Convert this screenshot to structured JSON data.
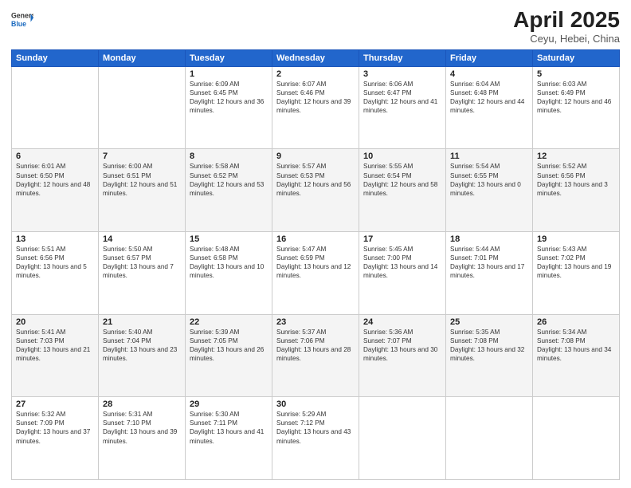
{
  "header": {
    "logo_general": "General",
    "logo_blue": "Blue",
    "title": "April 2025",
    "subtitle": "Ceyu, Hebei, China"
  },
  "days_of_week": [
    "Sunday",
    "Monday",
    "Tuesday",
    "Wednesday",
    "Thursday",
    "Friday",
    "Saturday"
  ],
  "weeks": [
    [
      {
        "day": "",
        "info": ""
      },
      {
        "day": "",
        "info": ""
      },
      {
        "day": "1",
        "info": "Sunrise: 6:09 AM\nSunset: 6:45 PM\nDaylight: 12 hours and 36 minutes."
      },
      {
        "day": "2",
        "info": "Sunrise: 6:07 AM\nSunset: 6:46 PM\nDaylight: 12 hours and 39 minutes."
      },
      {
        "day": "3",
        "info": "Sunrise: 6:06 AM\nSunset: 6:47 PM\nDaylight: 12 hours and 41 minutes."
      },
      {
        "day": "4",
        "info": "Sunrise: 6:04 AM\nSunset: 6:48 PM\nDaylight: 12 hours and 44 minutes."
      },
      {
        "day": "5",
        "info": "Sunrise: 6:03 AM\nSunset: 6:49 PM\nDaylight: 12 hours and 46 minutes."
      }
    ],
    [
      {
        "day": "6",
        "info": "Sunrise: 6:01 AM\nSunset: 6:50 PM\nDaylight: 12 hours and 48 minutes."
      },
      {
        "day": "7",
        "info": "Sunrise: 6:00 AM\nSunset: 6:51 PM\nDaylight: 12 hours and 51 minutes."
      },
      {
        "day": "8",
        "info": "Sunrise: 5:58 AM\nSunset: 6:52 PM\nDaylight: 12 hours and 53 minutes."
      },
      {
        "day": "9",
        "info": "Sunrise: 5:57 AM\nSunset: 6:53 PM\nDaylight: 12 hours and 56 minutes."
      },
      {
        "day": "10",
        "info": "Sunrise: 5:55 AM\nSunset: 6:54 PM\nDaylight: 12 hours and 58 minutes."
      },
      {
        "day": "11",
        "info": "Sunrise: 5:54 AM\nSunset: 6:55 PM\nDaylight: 13 hours and 0 minutes."
      },
      {
        "day": "12",
        "info": "Sunrise: 5:52 AM\nSunset: 6:56 PM\nDaylight: 13 hours and 3 minutes."
      }
    ],
    [
      {
        "day": "13",
        "info": "Sunrise: 5:51 AM\nSunset: 6:56 PM\nDaylight: 13 hours and 5 minutes."
      },
      {
        "day": "14",
        "info": "Sunrise: 5:50 AM\nSunset: 6:57 PM\nDaylight: 13 hours and 7 minutes."
      },
      {
        "day": "15",
        "info": "Sunrise: 5:48 AM\nSunset: 6:58 PM\nDaylight: 13 hours and 10 minutes."
      },
      {
        "day": "16",
        "info": "Sunrise: 5:47 AM\nSunset: 6:59 PM\nDaylight: 13 hours and 12 minutes."
      },
      {
        "day": "17",
        "info": "Sunrise: 5:45 AM\nSunset: 7:00 PM\nDaylight: 13 hours and 14 minutes."
      },
      {
        "day": "18",
        "info": "Sunrise: 5:44 AM\nSunset: 7:01 PM\nDaylight: 13 hours and 17 minutes."
      },
      {
        "day": "19",
        "info": "Sunrise: 5:43 AM\nSunset: 7:02 PM\nDaylight: 13 hours and 19 minutes."
      }
    ],
    [
      {
        "day": "20",
        "info": "Sunrise: 5:41 AM\nSunset: 7:03 PM\nDaylight: 13 hours and 21 minutes."
      },
      {
        "day": "21",
        "info": "Sunrise: 5:40 AM\nSunset: 7:04 PM\nDaylight: 13 hours and 23 minutes."
      },
      {
        "day": "22",
        "info": "Sunrise: 5:39 AM\nSunset: 7:05 PM\nDaylight: 13 hours and 26 minutes."
      },
      {
        "day": "23",
        "info": "Sunrise: 5:37 AM\nSunset: 7:06 PM\nDaylight: 13 hours and 28 minutes."
      },
      {
        "day": "24",
        "info": "Sunrise: 5:36 AM\nSunset: 7:07 PM\nDaylight: 13 hours and 30 minutes."
      },
      {
        "day": "25",
        "info": "Sunrise: 5:35 AM\nSunset: 7:08 PM\nDaylight: 13 hours and 32 minutes."
      },
      {
        "day": "26",
        "info": "Sunrise: 5:34 AM\nSunset: 7:08 PM\nDaylight: 13 hours and 34 minutes."
      }
    ],
    [
      {
        "day": "27",
        "info": "Sunrise: 5:32 AM\nSunset: 7:09 PM\nDaylight: 13 hours and 37 minutes."
      },
      {
        "day": "28",
        "info": "Sunrise: 5:31 AM\nSunset: 7:10 PM\nDaylight: 13 hours and 39 minutes."
      },
      {
        "day": "29",
        "info": "Sunrise: 5:30 AM\nSunset: 7:11 PM\nDaylight: 13 hours and 41 minutes."
      },
      {
        "day": "30",
        "info": "Sunrise: 5:29 AM\nSunset: 7:12 PM\nDaylight: 13 hours and 43 minutes."
      },
      {
        "day": "",
        "info": ""
      },
      {
        "day": "",
        "info": ""
      },
      {
        "day": "",
        "info": ""
      }
    ]
  ]
}
